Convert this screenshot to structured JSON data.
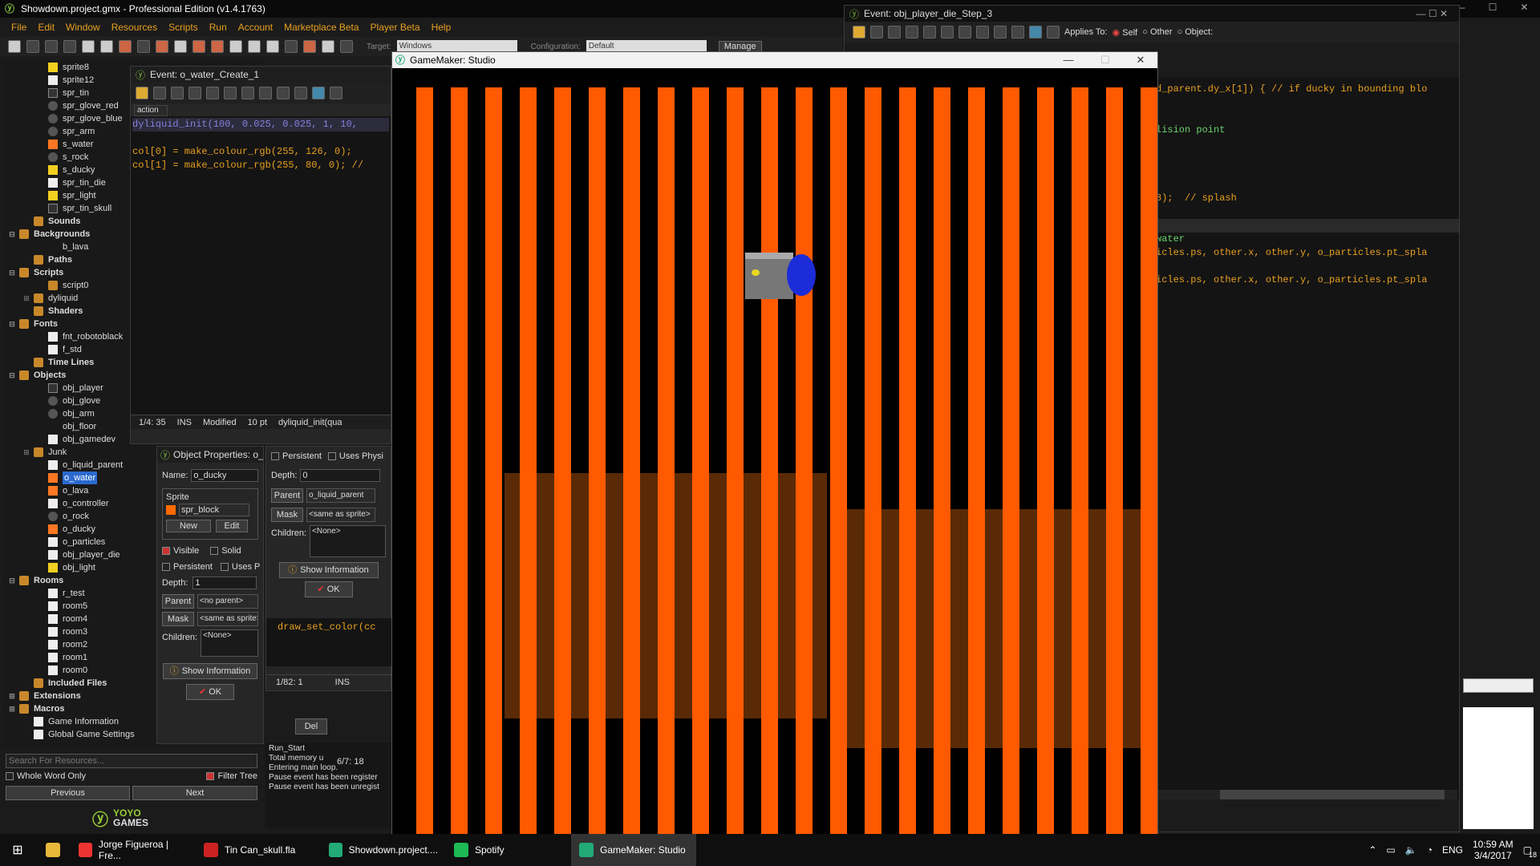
{
  "app_title": "Showdown.project.gmx - Professional Edition (v1.4.1763)",
  "menu": [
    "File",
    "Edit",
    "Window",
    "Resources",
    "Scripts",
    "Run",
    "Account",
    "Marketplace Beta",
    "Player Beta",
    "Help"
  ],
  "toolbar": {
    "target_label": "Target:",
    "target_value": "Windows",
    "config_label": "Configuration:",
    "config_value": "Default",
    "manage_label": "Manage"
  },
  "tree": [
    {
      "label": "sprite8",
      "icon": "y",
      "indent": 2
    },
    {
      "label": "sprite12",
      "icon": "s",
      "indent": 2
    },
    {
      "label": "spr_tin",
      "icon": "e",
      "indent": 2
    },
    {
      "label": "spr_glove_red",
      "icon": "d",
      "indent": 2
    },
    {
      "label": "spr_glove_blue",
      "icon": "d",
      "indent": 2
    },
    {
      "label": "spr_arm",
      "icon": "d",
      "indent": 2
    },
    {
      "label": "s_water",
      "icon": "o",
      "indent": 2
    },
    {
      "label": "s_rock",
      "icon": "d",
      "indent": 2
    },
    {
      "label": "s_ducky",
      "icon": "y",
      "indent": 2
    },
    {
      "label": "spr_tin_die",
      "icon": "s",
      "indent": 2
    },
    {
      "label": "spr_light",
      "icon": "y",
      "indent": 2
    },
    {
      "label": "spr_tin_skull",
      "icon": "e",
      "indent": 2
    },
    {
      "label": "Sounds",
      "icon": "f",
      "indent": 1,
      "folder": true
    },
    {
      "label": "Backgrounds",
      "icon": "f",
      "indent": 0,
      "folder": true,
      "exp": "⊟"
    },
    {
      "label": "b_lava",
      "icon": "",
      "indent": 2
    },
    {
      "label": "Paths",
      "icon": "f",
      "indent": 1,
      "folder": true
    },
    {
      "label": "Scripts",
      "icon": "f",
      "indent": 0,
      "folder": true,
      "exp": "⊟"
    },
    {
      "label": "script0",
      "icon": "f",
      "indent": 2
    },
    {
      "label": "dyliquid",
      "icon": "f",
      "indent": 1,
      "exp": "⊞"
    },
    {
      "label": "Shaders",
      "icon": "f",
      "indent": 1,
      "folder": true
    },
    {
      "label": "Fonts",
      "icon": "f",
      "indent": 0,
      "folder": true,
      "exp": "⊟"
    },
    {
      "label": "fnt_robotoblack",
      "icon": "s",
      "indent": 2
    },
    {
      "label": "f_std",
      "icon": "s",
      "indent": 2
    },
    {
      "label": "Time Lines",
      "icon": "f",
      "indent": 1,
      "folder": true
    },
    {
      "label": "Objects",
      "icon": "f",
      "indent": 0,
      "folder": true,
      "exp": "⊟"
    },
    {
      "label": "obj_player",
      "icon": "e",
      "indent": 2
    },
    {
      "label": "obj_glove",
      "icon": "d",
      "indent": 2
    },
    {
      "label": "obj_arm",
      "icon": "d",
      "indent": 2
    },
    {
      "label": "obj_floor",
      "icon": "",
      "indent": 2
    },
    {
      "label": "obj_gamedev",
      "icon": "s",
      "indent": 2
    },
    {
      "label": "Junk",
      "icon": "f",
      "indent": 1,
      "exp": "⊞"
    },
    {
      "label": "o_liquid_parent",
      "icon": "s",
      "indent": 2
    },
    {
      "label": "o_water",
      "icon": "o",
      "indent": 2,
      "selected": true
    },
    {
      "label": "o_lava",
      "icon": "o",
      "indent": 2
    },
    {
      "label": "o_controller",
      "icon": "s",
      "indent": 2
    },
    {
      "label": "o_rock",
      "icon": "d",
      "indent": 2
    },
    {
      "label": "o_ducky",
      "icon": "o",
      "indent": 2
    },
    {
      "label": "o_particles",
      "icon": "s",
      "indent": 2
    },
    {
      "label": "obj_player_die",
      "icon": "s",
      "indent": 2
    },
    {
      "label": "obj_light",
      "icon": "y",
      "indent": 2
    },
    {
      "label": "Rooms",
      "icon": "f",
      "indent": 0,
      "folder": true,
      "exp": "⊟"
    },
    {
      "label": "r_test",
      "icon": "s",
      "indent": 2
    },
    {
      "label": "room5",
      "icon": "s",
      "indent": 2
    },
    {
      "label": "room4",
      "icon": "s",
      "indent": 2
    },
    {
      "label": "room3",
      "icon": "s",
      "indent": 2
    },
    {
      "label": "room2",
      "icon": "s",
      "indent": 2
    },
    {
      "label": "room1",
      "icon": "s",
      "indent": 2
    },
    {
      "label": "room0",
      "icon": "s",
      "indent": 2
    },
    {
      "label": "Included Files",
      "icon": "f",
      "indent": 1,
      "folder": true
    },
    {
      "label": "Extensions",
      "icon": "f",
      "indent": 0,
      "folder": true,
      "exp": "⊞"
    },
    {
      "label": "Macros",
      "icon": "f",
      "indent": 0,
      "folder": true,
      "exp": "⊞"
    },
    {
      "label": "Game Information",
      "icon": "s",
      "indent": 1
    },
    {
      "label": "Global Game Settings",
      "icon": "s",
      "indent": 1
    }
  ],
  "tree_bottom": {
    "search_placeholder": "Search For Resources...",
    "whole_word": "Whole Word Only",
    "filter_tree": "Filter Tree",
    "previous": "Previous",
    "next": "Next",
    "logo_top": "YOYO",
    "logo_bottom": "GAMES"
  },
  "create_event": {
    "title": "Event: o_water_Create_1",
    "tab": "action",
    "lines": [
      "dyliquid_init(100, 0.025, 0.025, 1, 10,",
      "",
      "col[0] = make_colour_rgb(255, 126, 0);",
      "col[1] = make_colour_rgb(255, 80, 0); //"
    ],
    "status": {
      "pos": "1/4: 35",
      "mode": "INS",
      "modified": "Modified",
      "size": "10 pt",
      "fn": "dyliquid_init(qua"
    }
  },
  "obj_props": {
    "title": "Object Properties: o_",
    "name_label": "Name:",
    "name_value": "o_ducky",
    "sprite_label": "Sprite",
    "sprite_value": "spr_block",
    "new_label": "New",
    "edit_label": "Edit",
    "visible": "Visible",
    "solid": "Solid",
    "persistent": "Persistent",
    "uses_p": "Uses P",
    "depth_label": "Depth:",
    "depth_value": "1",
    "parent_label": "Parent",
    "parent_value": "<no parent>",
    "mask_label": "Mask",
    "mask_value": "<same as sprite>",
    "children_label": "Children:",
    "children_value": "<None>",
    "show_info": "Show Information",
    "ok": "OK"
  },
  "obj_props2": {
    "persistent": "Persistent",
    "uses_physics": "Uses Physi",
    "depth_label": "Depth:",
    "depth_value": "0",
    "parent_label": "Parent",
    "parent_value": "o_liquid_parent",
    "mask_label": "Mask",
    "mask_value": "<same as sprite>",
    "children_label": "Children:",
    "children_value": "<None>",
    "show_info": "Show Information",
    "ok": "OK",
    "code_line": "draw_set_color(cc",
    "status_pos": "1/82: 1",
    "status_mode": "INS",
    "del": "Del"
  },
  "compile_log": {
    "lines": [
      "Run_Start",
      "Total memory u",
      "Entering main loop.",
      "Pause event has been register",
      "Pause event has been unregist"
    ],
    "status": "6/7: 18"
  },
  "step_event": {
    "title": "Event: obj_player_die_Step_3",
    "applies_to": "Applies To:",
    "self": "Self",
    "other": "Other",
    "object": "Object:",
    "lines": [
      {
        "text": "d_parent.dy_x[1]) { // if ducky in bounding blo",
        "color": "#e8a020"
      },
      {
        "text": "",
        "color": "#e8a020"
      },
      {
        "text": "",
        "color": "#e8a020"
      },
      {
        "text": "lision point",
        "color": "#6bd46b"
      },
      {
        "text": "",
        "color": "#e8a020"
      },
      {
        "text": "",
        "color": "#e8a020"
      },
      {
        "text": "",
        "color": "#e8a020"
      },
      {
        "text": "",
        "color": "#e8a020"
      },
      {
        "text": "8);  // splash",
        "color": "#e8a020"
      },
      {
        "text": "",
        "color": "#e8a020"
      },
      {
        "text": "",
        "color": "#e8a020"
      },
      {
        "text": "water",
        "color": "#6bd46b"
      },
      {
        "text": "icles.ps, other.x, other.y, o_particles.pt_spla",
        "color": "#e8a020"
      },
      {
        "text": "",
        "color": "#e8a020"
      },
      {
        "text": "icles.ps, other.x, other.y, o_particles.pt_spla",
        "color": "#e8a020"
      }
    ]
  },
  "game_window": {
    "title": "GameMaker: Studio",
    "min": "—",
    "max": "☐",
    "close": "✕"
  },
  "taskbar": {
    "items": [
      {
        "label": "Jorge Figueroa | Fre...",
        "color": "#e33"
      },
      {
        "label": "Tin Can_skull.fla",
        "color": "#c22"
      },
      {
        "label": "Showdown.project....",
        "color": "#2a7"
      },
      {
        "label": "Spotify",
        "color": "#1db954"
      },
      {
        "label": "GameMaker: Studio",
        "color": "#2a7",
        "active": true
      }
    ],
    "lang": "ENG",
    "time": "10:59 AM",
    "date": "3/4/2017",
    "notif": "18"
  }
}
